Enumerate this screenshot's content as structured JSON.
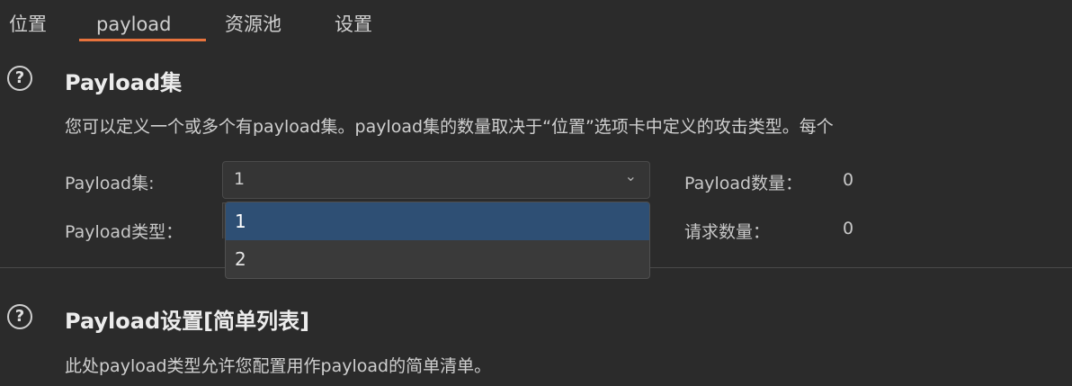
{
  "tabs": [
    {
      "label": "位置"
    },
    {
      "label": "payload"
    },
    {
      "label": "资源池"
    },
    {
      "label": "设置"
    }
  ],
  "active_tab": "payload",
  "accent_color": "#e8733d",
  "payload_sets": {
    "help_glyph": "?",
    "title": "Payload集",
    "description": "您可以定义一个或多个有payload集。payload集的数量取决于“位置”选项卡中定义的攻击类型。每个",
    "set_label": "Payload集:",
    "set_value": "1",
    "type_label": "Payload类型：",
    "count_label": "Payload数量：",
    "count_value": "0",
    "request_label": "请求数量：",
    "request_value": "0",
    "dropdown_options": [
      "1",
      "2"
    ],
    "dropdown_selected": "1"
  },
  "payload_settings": {
    "help_glyph": "?",
    "title": "Payload设置[简单列表]",
    "description": "此处payload类型允许您配置用作payload的简单清单。"
  }
}
